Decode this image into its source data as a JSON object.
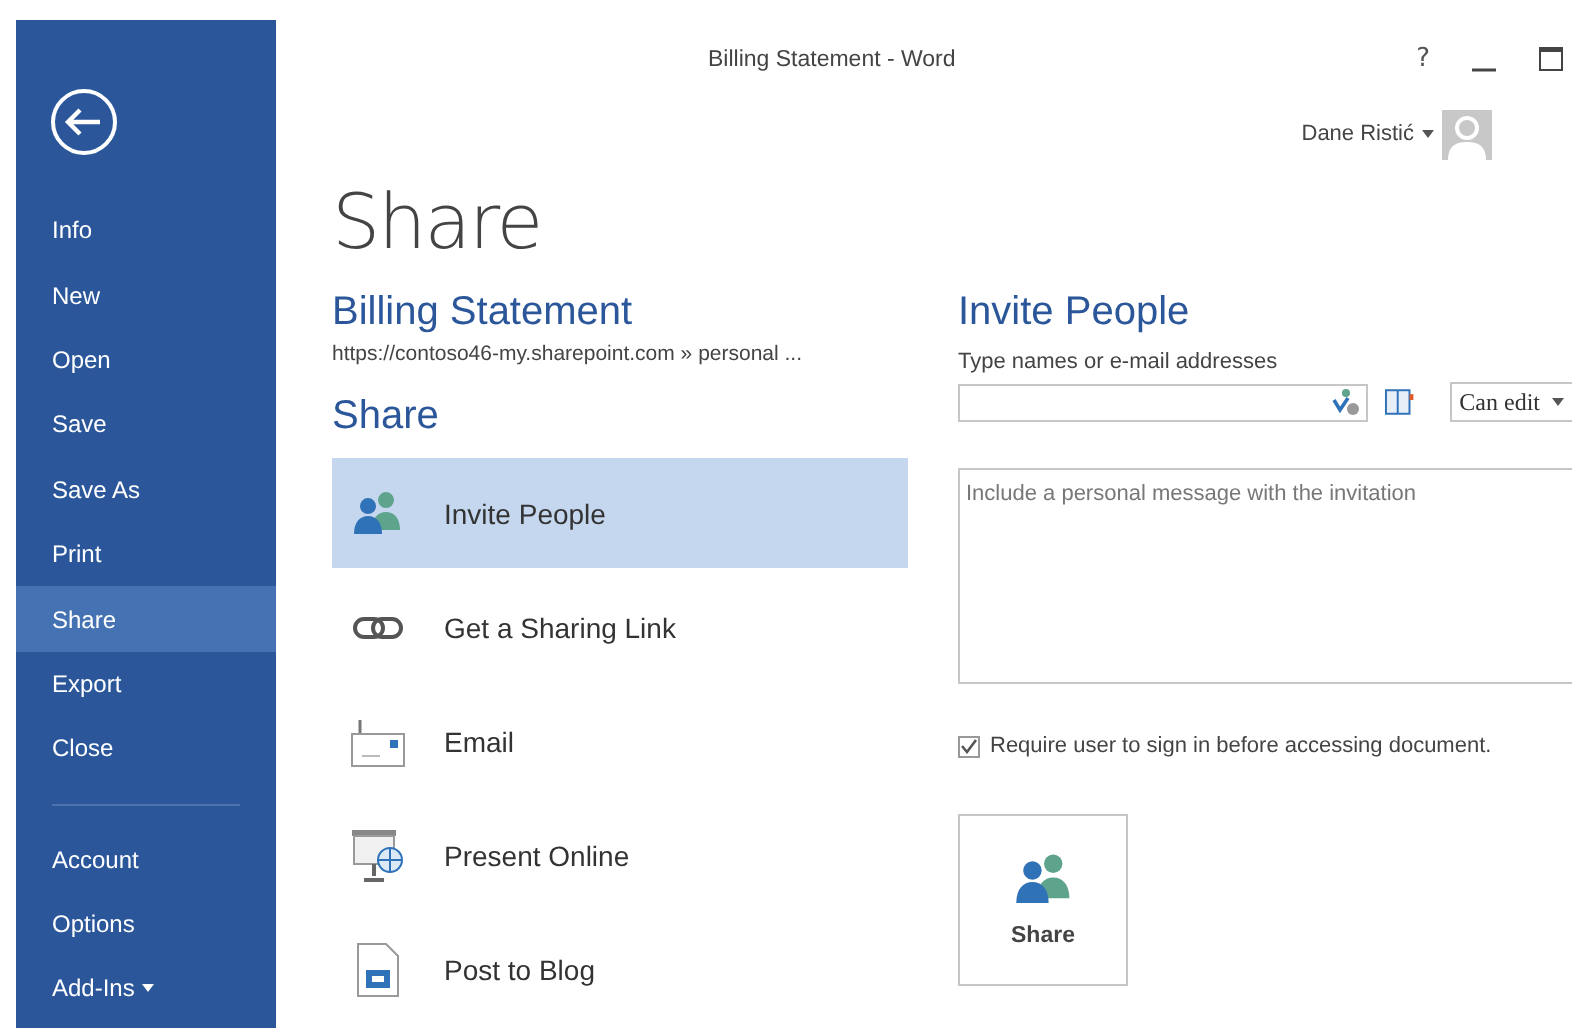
{
  "window": {
    "title": "Billing Statement - Word",
    "help": "?"
  },
  "user": {
    "name": "Dane Ristić"
  },
  "sidebar": {
    "items": [
      {
        "label": "Info",
        "selected": false
      },
      {
        "label": "New",
        "selected": false
      },
      {
        "label": "Open",
        "selected": false
      },
      {
        "label": "Save",
        "selected": false
      },
      {
        "label": "Save As",
        "selected": false
      },
      {
        "label": "Print",
        "selected": false
      },
      {
        "label": "Share",
        "selected": true
      },
      {
        "label": "Export",
        "selected": false
      },
      {
        "label": "Close",
        "selected": false
      }
    ],
    "bottom_items": [
      {
        "label": "Account",
        "selected": false
      },
      {
        "label": "Options",
        "selected": false
      },
      {
        "label": "Add-Ins",
        "selected": false,
        "dropdown": true
      }
    ]
  },
  "page_title": "Share",
  "document": {
    "name": "Billing Statement",
    "path": "https://contoso46-my.sharepoint.com » personal ..."
  },
  "share": {
    "heading": "Share",
    "options": [
      {
        "label": "Invite People",
        "kind": "people",
        "selected": true
      },
      {
        "label": "Get a Sharing Link",
        "kind": "link",
        "selected": false
      },
      {
        "label": "Email",
        "kind": "email",
        "selected": false
      },
      {
        "label": "Present Online",
        "kind": "present",
        "selected": false
      },
      {
        "label": "Post to Blog",
        "kind": "blog",
        "selected": false
      }
    ]
  },
  "invite": {
    "heading": "Invite People",
    "names_label": "Type names or e-mail addresses",
    "permission": "Can edit",
    "message_placeholder": "Include a personal message with the invitation",
    "require_sign_in": {
      "label": "Require user to sign in before accessing document.",
      "checked": true
    },
    "share_button": "Share"
  }
}
